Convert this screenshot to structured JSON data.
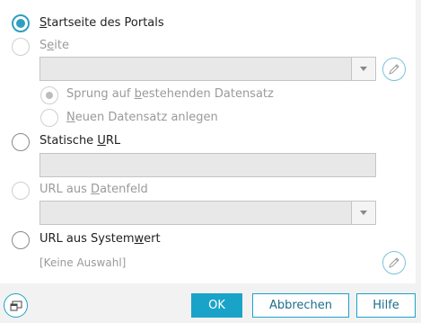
{
  "options": {
    "portal_home": {
      "label_underlined": "S",
      "label_rest": "tartseite des Portals",
      "checked": true
    },
    "page": {
      "label_prefix": "S",
      "label_underlined": "e",
      "label_rest": "ite",
      "enabled": false
    },
    "page_sub": {
      "jump": {
        "label_prefix": "Sprung auf ",
        "label_underlined": "b",
        "label_rest": "estehenden Datensatz",
        "checked": true
      },
      "new": {
        "label_underlined": "N",
        "label_rest": "euen Datensatz anlegen"
      }
    },
    "static_url": {
      "label_prefix": "Statische ",
      "label_underlined": "U",
      "label_rest": "RL",
      "value": ""
    },
    "url_field": {
      "label_prefix": "URL aus ",
      "label_underlined": "D",
      "label_rest": "atenfeld",
      "enabled": false
    },
    "url_system": {
      "label_prefix": "URL aus System",
      "label_underlined": "w",
      "label_rest": "ert",
      "selection": "[Keine Auswahl]"
    }
  },
  "buttons": {
    "ok": "OK",
    "cancel": "Abbrechen",
    "help": "Hilfe"
  },
  "colors": {
    "accent": "#1aa3c9",
    "radio_accent": "#2f9fc1"
  },
  "icons": {
    "edit": "pencil-icon",
    "corner": "window-icon",
    "dropdown": "chevron-down-icon"
  }
}
